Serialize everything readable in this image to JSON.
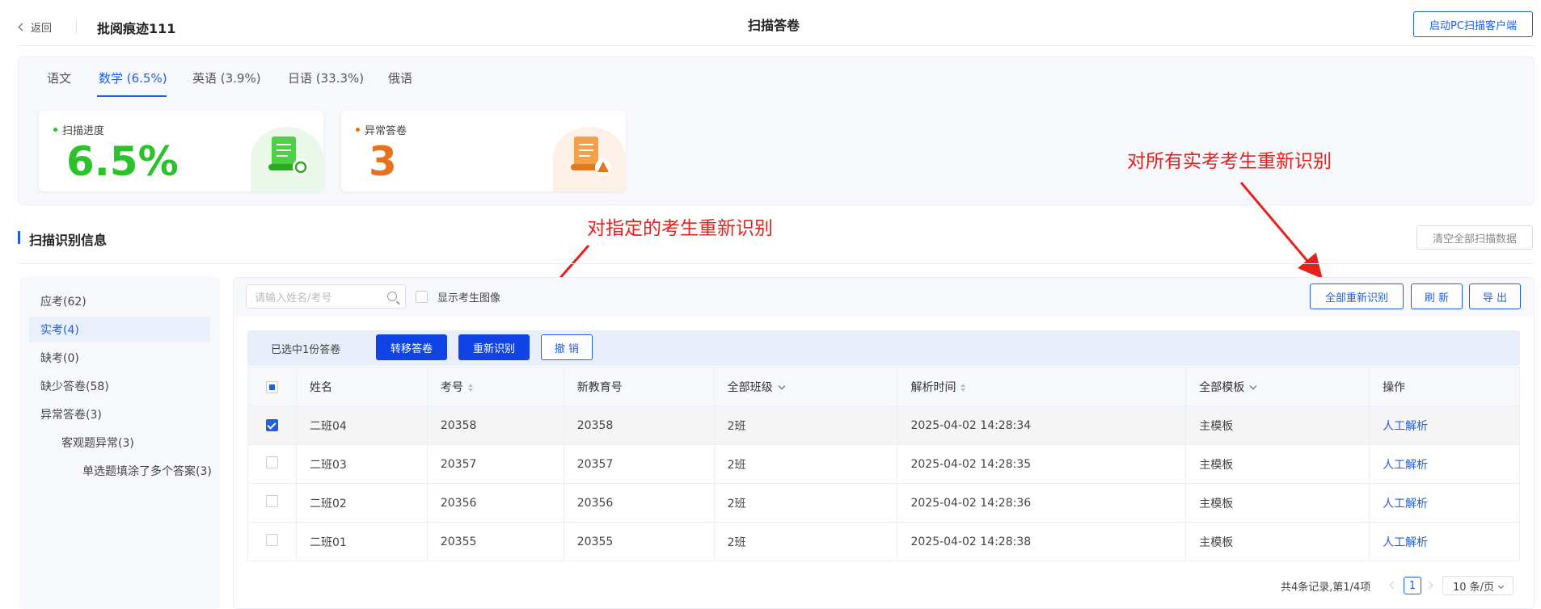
{
  "header": {
    "back_label": "返回",
    "exam_title": "批阅痕迹111",
    "page_title": "扫描答卷",
    "pc_button": "启动PC扫描客户端"
  },
  "subject_tabs": [
    {
      "label": "语文",
      "active": false
    },
    {
      "label": "数学 (6.5%)",
      "active": true
    },
    {
      "label": "英语 (3.9%)",
      "active": false
    },
    {
      "label": "日语 (33.3%)",
      "active": false
    },
    {
      "label": "俄语",
      "active": false
    }
  ],
  "stats": {
    "progress_label": "扫描进度",
    "progress_value": "6.5%",
    "progress_color": "#2bc22b",
    "abnormal_label": "异常答卷",
    "abnormal_value": "3",
    "abnormal_color": "#e8711e"
  },
  "annotations": {
    "specific": "对指定的考生重新识别",
    "all": "对所有实考考生重新识别"
  },
  "section": {
    "title": "扫描识别信息",
    "clear_button": "清空全部扫描数据"
  },
  "sidebar": {
    "items": [
      {
        "label": "应考(62)"
      },
      {
        "label": "实考(4)"
      },
      {
        "label": "缺考(0)"
      },
      {
        "label": "缺少答卷(58)"
      },
      {
        "label": "异常答卷(3)"
      },
      {
        "label": "客观题异常(3)"
      },
      {
        "label": "单选题填涂了多个答案(3)"
      }
    ]
  },
  "toolbar": {
    "search_placeholder": "请输入姓名/考号",
    "show_image_label": "显示考生图像",
    "rerecognize_all": "全部重新识别",
    "refresh": "刷 新",
    "export": "导 出"
  },
  "selection": {
    "count_text": "已选中1份答卷",
    "transfer": "转移答卷",
    "rerecognize": "重新识别",
    "undo": "撤 销"
  },
  "table": {
    "headers": [
      "姓名",
      "考号",
      "新教育号",
      "全部班级",
      "解析时间",
      "全部模板",
      "操作"
    ],
    "rows": [
      {
        "checked": true,
        "name": "二班04",
        "exam_no": "20358",
        "edu_no": "20358",
        "class": "2班",
        "time": "2025-04-02 14:28:34",
        "template": "主模板",
        "action": "人工解析"
      },
      {
        "checked": false,
        "name": "二班03",
        "exam_no": "20357",
        "edu_no": "20357",
        "class": "2班",
        "time": "2025-04-02 14:28:35",
        "template": "主模板",
        "action": "人工解析"
      },
      {
        "checked": false,
        "name": "二班02",
        "exam_no": "20356",
        "edu_no": "20356",
        "class": "2班",
        "time": "2025-04-02 14:28:36",
        "template": "主模板",
        "action": "人工解析"
      },
      {
        "checked": false,
        "name": "二班01",
        "exam_no": "20355",
        "edu_no": "20355",
        "class": "2班",
        "time": "2025-04-02 14:28:38",
        "template": "主模板",
        "action": "人工解析"
      }
    ]
  },
  "pagination": {
    "total_text": "共4条记录,第1/4项",
    "current_page": "1",
    "page_size": "10 条/页"
  },
  "colors": {
    "primary": "#1f5fe0",
    "button_fill": "#1144e6",
    "annotation_red": "#e8201c"
  }
}
